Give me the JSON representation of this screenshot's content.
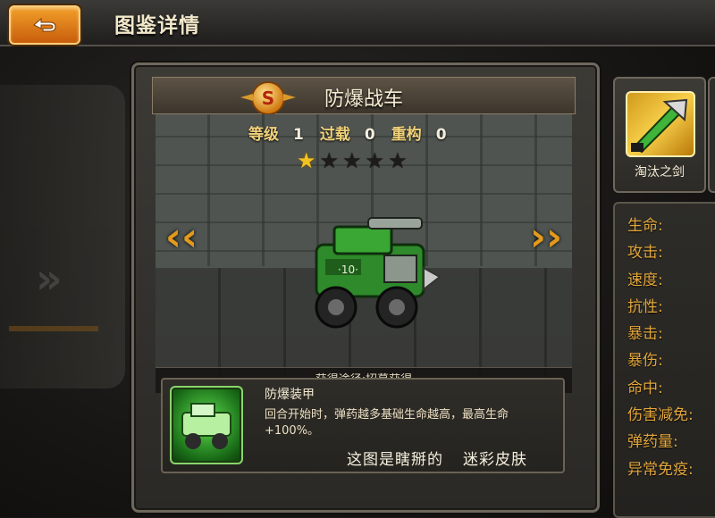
{
  "header": {
    "title": "图鉴详情"
  },
  "unit": {
    "name": "防爆战车",
    "rank_badge": "S",
    "level_label": "等级",
    "level_value": "1",
    "overload_label": "过载",
    "overload_value": "0",
    "rebuild_label": "重构",
    "rebuild_value": "0",
    "stars_total": 5,
    "stars_filled": 1,
    "source": "获得途径:招募获得"
  },
  "skill": {
    "name": "防爆装甲",
    "description": "回合开始时，弹药越多基础生命越高，最高生命+100%。",
    "note_left": "这图是瞎掰的",
    "note_right": "迷彩皮肤"
  },
  "equipment": {
    "name": "淘汰之剑"
  },
  "attributes": [
    "生命:",
    "攻击:",
    "速度:",
    "抗性:",
    "暴击:",
    "暴伤:",
    "命中:",
    "伤害减免:",
    "弹药量:",
    "异常免疫:"
  ],
  "colors": {
    "accent": "#e39a1c",
    "attr_text": "#e3a63c",
    "star_on": "#f2c224"
  }
}
